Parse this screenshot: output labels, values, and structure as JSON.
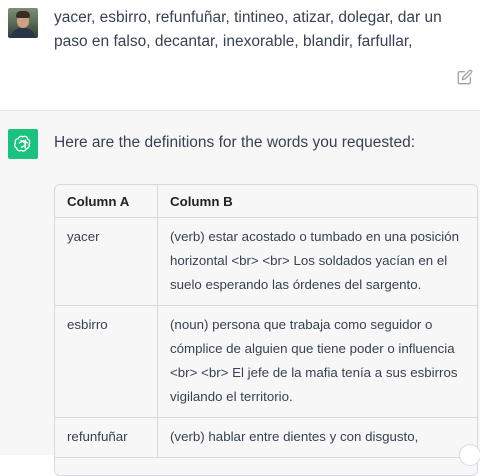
{
  "user_message": {
    "text": "yacer, esbirro, refunfuñar, tintineo, atizar, dolegar, dar un paso en falso, decantar, inexorable, blandir, farfullar,"
  },
  "assistant_message": {
    "intro": "Here are the definitions for the words you requested:",
    "table": {
      "headers": [
        "Column A",
        "Column B"
      ],
      "rows": [
        {
          "a": "yacer",
          "b": "(verb) estar acostado o tumbado en una posición horizontal <br> <br> Los soldados yacían en el suelo esperando las órdenes del sargento."
        },
        {
          "a": "esbirro",
          "b": "(noun) persona que trabaja como seguidor o cómplice de alguien que tiene poder o influencia <br> <br> El jefe de la mafia tenía a sus esbirros vigilando el territorio."
        },
        {
          "a": "refunfuñar",
          "b": "(verb) hablar entre dientes y con disgusto,"
        }
      ]
    }
  },
  "colors": {
    "assistant_bg": "#f7f7f8",
    "logo_green": "#19c37d",
    "border": "#d9d9e3"
  },
  "icons": {
    "edit": "edit-icon",
    "logo": "openai-logo-icon"
  }
}
